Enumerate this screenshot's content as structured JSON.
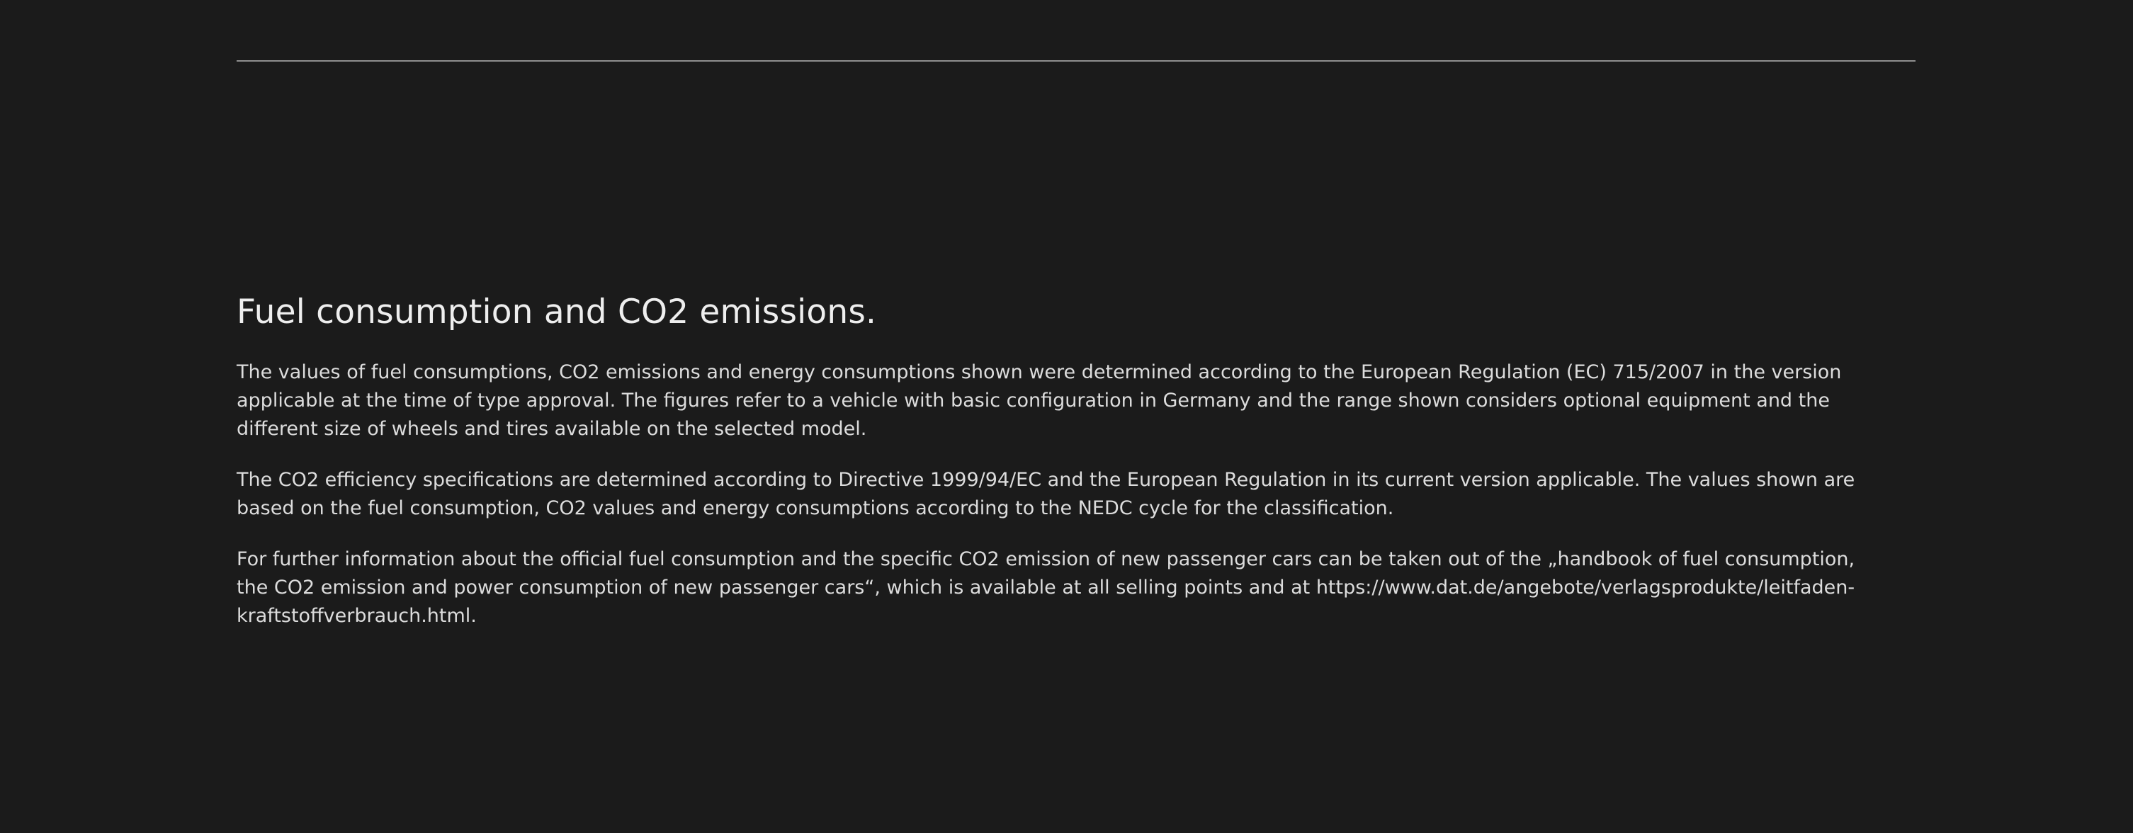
{
  "disclaimer": {
    "title": "Fuel consumption and CO2 emissions.",
    "paragraphs": [
      "The values of fuel consumptions, CO2 emissions and energy consumptions shown were determined according to the European Regulation (EC) 715/2007 in the version applicable at the time of type approval. The figures refer to a vehicle with basic configuration in Germany and the range shown considers optional equipment and the different size of wheels and tires available on the selected model.",
      "The CO2 efficiency specifications are determined according to Directive 1999/94/EC and the European Regulation in its current version applicable. The values shown are based on the fuel consumption, CO2 values and energy consumptions according to the NEDC cycle for the classification.",
      "For further information about the official fuel consumption and the specific CO2 emission of new passenger cars can be taken out of the „handbook of fuel consumption, the CO2 emission and power consumption of new passenger cars“, which is available at all selling points and at https://www.dat.de/angebote/verlagsprodukte/leitfaden-kraftstoffverbrauch.html."
    ]
  },
  "colors": {
    "background": "#1b1b1b",
    "text": "#e6e6e6",
    "rule": "#8f8f8f"
  }
}
